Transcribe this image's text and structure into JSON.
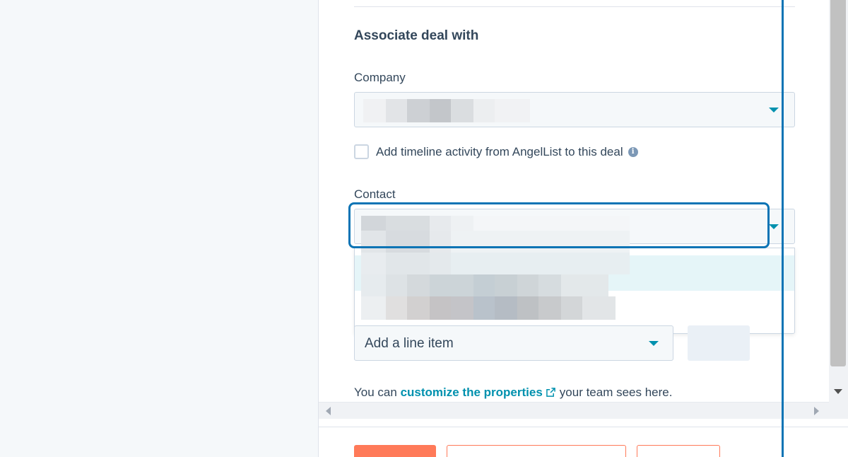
{
  "panel": {
    "section_title": "Associate deal with",
    "company": {
      "label": "Company",
      "selected_value_redacted": true
    },
    "timeline_checkbox": {
      "label": "Add timeline activity from AngelList to this deal",
      "checked": false,
      "icon": "info-icon"
    },
    "contact": {
      "label": "Contact",
      "focused": true,
      "dropdown_open": true,
      "options_redacted": true
    },
    "line_item": {
      "select_value": "Add a line item"
    },
    "help": {
      "prefix": "You can",
      "link_label": "customize the properties",
      "suffix": "your team sees here.",
      "icon": "external-link-icon"
    }
  },
  "colors": {
    "accent": "#0091ae",
    "primary_button": "#ff7a59",
    "focus": "#0b74b5",
    "text": "#33475b"
  }
}
